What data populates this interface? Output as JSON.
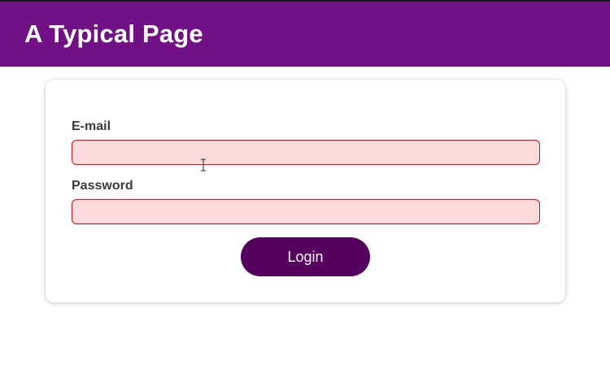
{
  "header": {
    "title": "A Typical Page",
    "background_color": "#721086"
  },
  "login_form": {
    "email_label": "E-mail",
    "email_value": "",
    "password_label": "Password",
    "password_value": "",
    "login_label": "Login",
    "field_background_color": "#fadada",
    "field_border_color": "#cc1111",
    "button_color": "#55005e"
  },
  "cursor": {
    "icon": "text-cursor-icon"
  }
}
